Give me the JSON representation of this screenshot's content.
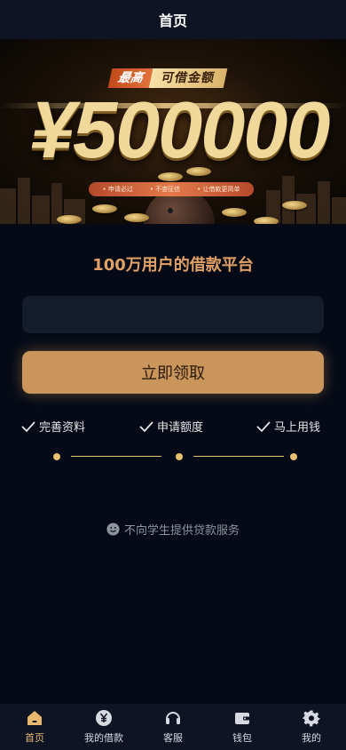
{
  "header": {
    "title": "首页"
  },
  "banner": {
    "badge_left": "最高",
    "badge_right": "可借金额",
    "amount": "¥500000",
    "pill_items": [
      "申请必过",
      "不查征信",
      "让借款更简单"
    ]
  },
  "main": {
    "subtitle": "100万用户的借款平台",
    "input": {
      "value": "",
      "placeholder": ""
    },
    "cta_label": "立即领取",
    "steps": [
      "完善资料",
      "申请额度",
      "马上用钱"
    ],
    "notice": "不向学生提供贷款服务"
  },
  "tabbar": {
    "items": [
      {
        "label": "首页",
        "icon": "home-icon",
        "active": true
      },
      {
        "label": "我的借款",
        "icon": "yen-coin-icon",
        "active": false
      },
      {
        "label": "客服",
        "icon": "headset-icon",
        "active": false
      },
      {
        "label": "钱包",
        "icon": "wallet-icon",
        "active": false
      },
      {
        "label": "我的",
        "icon": "gear-icon",
        "active": false
      }
    ]
  },
  "colors": {
    "accent": "#c9955a",
    "active_tab": "#e7b870",
    "subtitle": "#e0a066",
    "background": "#050a16"
  }
}
